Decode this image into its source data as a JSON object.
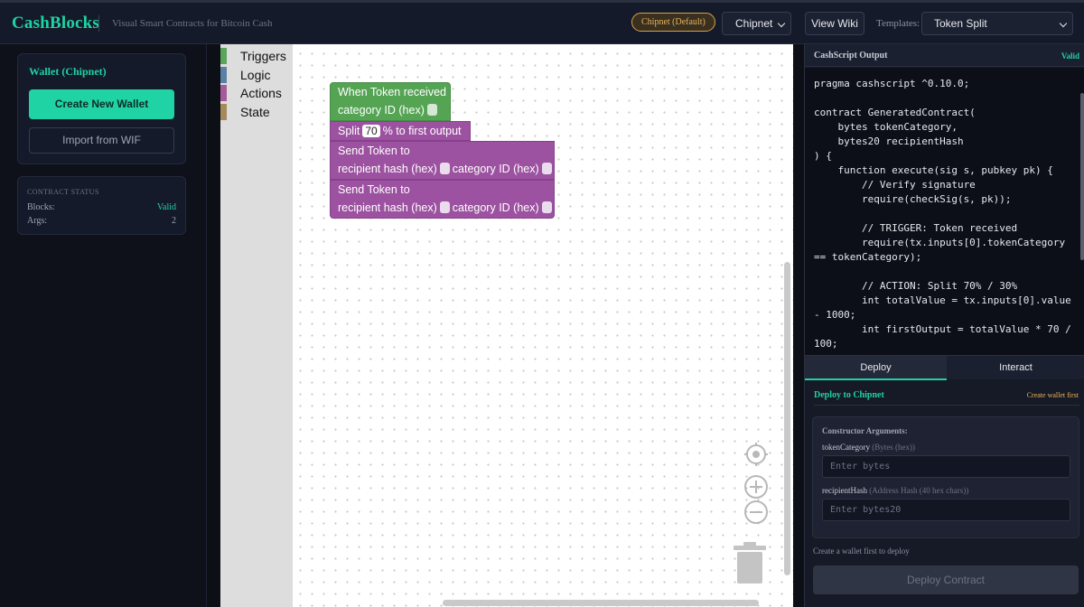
{
  "header": {
    "brand": "CashBlocks",
    "tagline": "Visual Smart Contracts for Bitcoin Cash",
    "network_badge": "Chipnet (Default)",
    "network_select": "Chipnet",
    "wiki_button": "View Wiki",
    "templates_label": "Templates:",
    "template_select": "Token Split"
  },
  "sidebar": {
    "wallet_title": "Wallet (Chipnet)",
    "create_wallet": "Create New Wallet",
    "import_wif": "Import from WIF",
    "status_title": "CONTRACT STATUS",
    "blocks_label": "Blocks:",
    "blocks_value": "Valid",
    "args_label": "Args:",
    "args_value": "2"
  },
  "toolbox": {
    "categories": [
      {
        "label": "Triggers",
        "color": "#5ba55b"
      },
      {
        "label": "Logic",
        "color": "#5b80a5"
      },
      {
        "label": "Actions",
        "color": "#a55b99"
      },
      {
        "label": "State",
        "color": "#a5895b"
      }
    ]
  },
  "blocks": {
    "trigger_line1": "When Token received",
    "trigger_line2": "category ID (hex)",
    "split_prefix": "Split",
    "split_value": "70",
    "split_suffix": "% to first output",
    "send1_line1": "Send Token to",
    "send1_recipient": "recipient hash (hex)",
    "send1_category": "category ID (hex)",
    "send2_line1": "Send Token to",
    "send2_recipient": "recipient hash (hex)",
    "send2_category": "category ID (hex)"
  },
  "output": {
    "title": "CashScript Output",
    "status": "Valid",
    "code_lines": [
      "pragma cashscript ^0.10.0;",
      "",
      "contract GeneratedContract(",
      "    bytes tokenCategory,",
      "    bytes20 recipientHash",
      ") {",
      "    function execute(sig s, pubkey pk) {",
      "        // Verify signature",
      "        require(checkSig(s, pk));",
      "",
      "        // TRIGGER: Token received",
      "        require(tx.inputs[0].tokenCategory",
      "== tokenCategory);",
      "",
      "        // ACTION: Split 70% / 30%",
      "        int totalValue = tx.inputs[0].value",
      "- 1000;",
      "        int firstOutput = totalValue * 70 /",
      "100;"
    ]
  },
  "tabs": {
    "deploy": "Deploy",
    "interact": "Interact"
  },
  "deploy": {
    "title": "Deploy to Chipnet",
    "hint": "Create wallet first",
    "args_title": "Constructor Arguments:",
    "arg1_name": "tokenCategory",
    "arg1_type": "(Bytes (hex))",
    "arg1_placeholder": "Enter bytes",
    "arg2_name": "recipientHash",
    "arg2_type": "(Address Hash (40 hex chars))",
    "arg2_placeholder": "Enter bytes20",
    "note": "Create a wallet first to deploy",
    "button": "Deploy Contract"
  }
}
